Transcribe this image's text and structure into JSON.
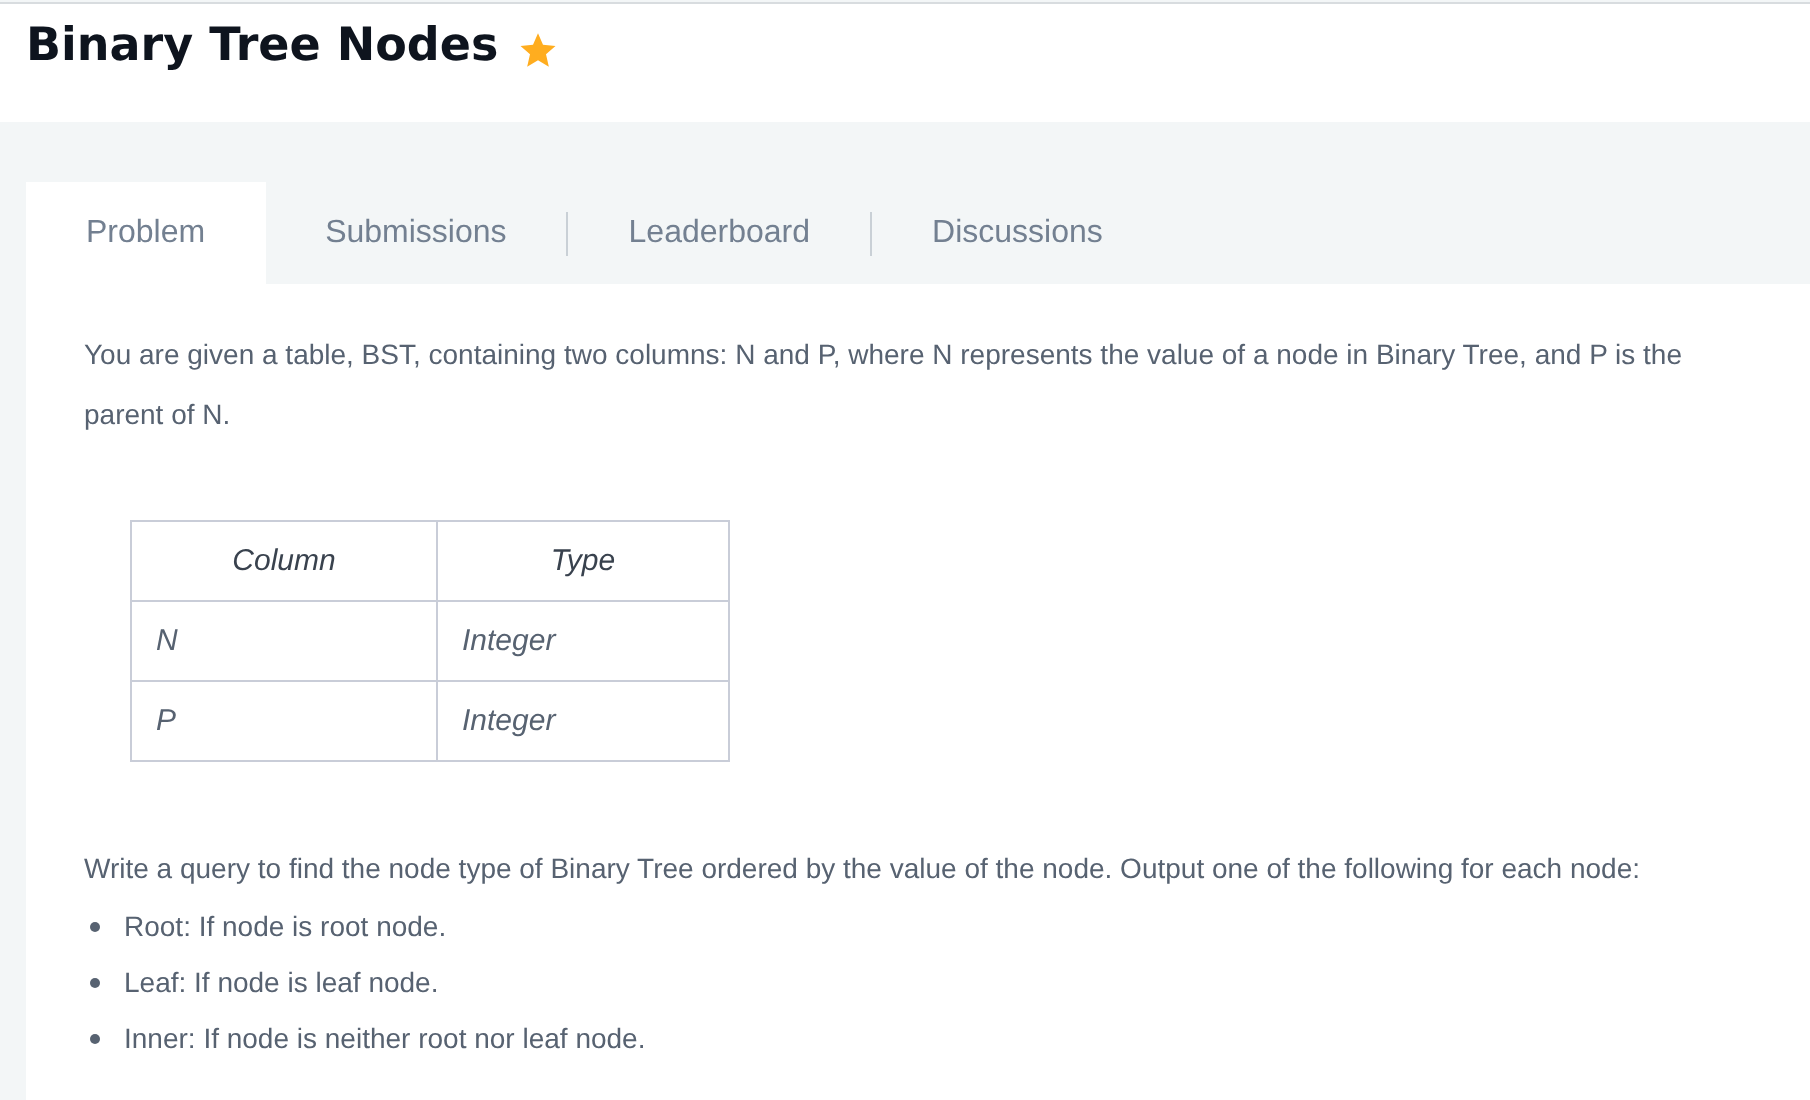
{
  "header": {
    "title": "Binary Tree Nodes",
    "starred": true
  },
  "tabs": [
    {
      "label": "Problem",
      "selected": true
    },
    {
      "label": "Submissions",
      "selected": false
    },
    {
      "label": "Leaderboard",
      "selected": false
    },
    {
      "label": "Discussions",
      "selected": false
    }
  ],
  "intro": "You are given a table, BST, containing two columns: N and P, where N represents the value of a node in Binary Tree, and P is the parent of N.",
  "table": {
    "columns": [
      "Column",
      "Type"
    ],
    "rows": [
      [
        "N",
        "Integer"
      ],
      [
        "P",
        "Integer"
      ]
    ]
  },
  "task": "Write a query to find the node type of Binary Tree ordered by the value of the node. Output one of the following for each node:",
  "bullets": [
    "Root: If node is root node.",
    "Leaf: If node is leaf node.",
    "Inner: If node is neither root nor leaf node."
  ]
}
